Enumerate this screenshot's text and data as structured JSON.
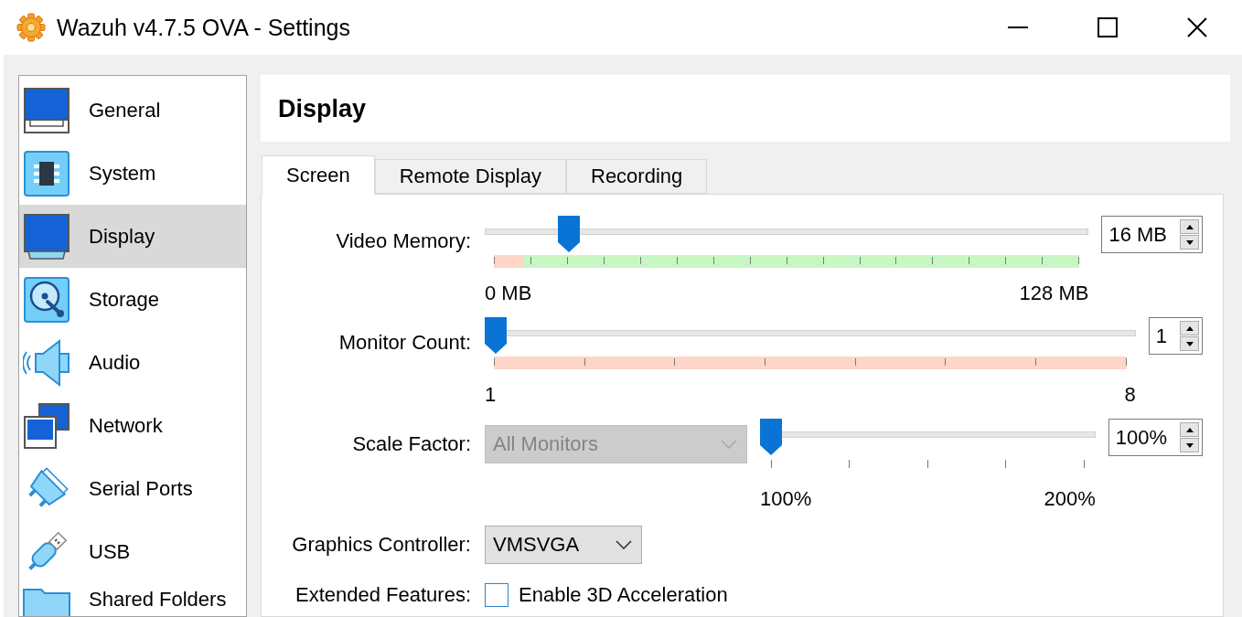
{
  "window": {
    "title": "Wazuh v4.7.5 OVA - Settings"
  },
  "sidebar": {
    "items": [
      {
        "label": "General",
        "selected": false
      },
      {
        "label": "System",
        "selected": false
      },
      {
        "label": "Display",
        "selected": true
      },
      {
        "label": "Storage",
        "selected": false
      },
      {
        "label": "Audio",
        "selected": false
      },
      {
        "label": "Network",
        "selected": false
      },
      {
        "label": "Serial Ports",
        "selected": false
      },
      {
        "label": "USB",
        "selected": false
      },
      {
        "label": "Shared Folders",
        "selected": false
      }
    ]
  },
  "page": {
    "title": "Display"
  },
  "tabs": [
    {
      "label": "Screen",
      "selected": true
    },
    {
      "label": "Remote Display",
      "selected": false
    },
    {
      "label": "Recording",
      "selected": false
    }
  ],
  "screen": {
    "rows": [
      {
        "kind": "slider",
        "label": "Video Memory:",
        "level": 0.125,
        "recommended": {
          "level": 0.95
        },
        "min_label": "0 MB",
        "max_label": "128 MB",
        "value": "16 MB"
      },
      {
        "kind": "slider",
        "label": "Monitor Count:",
        "level": 0,
        "recommended": {
          "level": 0
        },
        "min_label": "1",
        "max_label": "8",
        "value": "1"
      },
      {
        "kind": "slider",
        "label": "Scale Factor:",
        "combo": {
          "value": "All Monitors",
          "disabled": true
        },
        "level": 0,
        "min_label": "100%",
        "max_label": "200%",
        "value": "100%"
      },
      {
        "kind": "combo",
        "label": "Graphics Controller:",
        "combo": {
          "value": "VMSVGA",
          "disabled": false
        }
      },
      {
        "kind": "checkbox",
        "label": "Extended Features:",
        "option": "Enable 3D Acceleration",
        "checked": false
      }
    ]
  }
}
